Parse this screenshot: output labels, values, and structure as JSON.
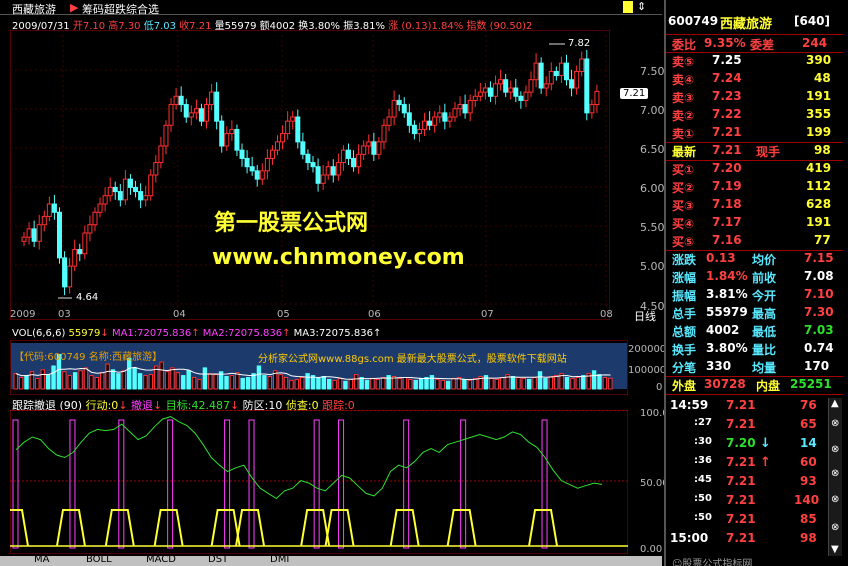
{
  "window": {
    "stock_name": "西藏旅游",
    "scheme_tab": "筹码超跌综合选",
    "code": "600749",
    "panel_stock": "西藏旅游",
    "panel_index": "[640]"
  },
  "info_bar": {
    "date": "2009/07/31",
    "open": "开7.10",
    "high": "高7.30",
    "low": "低7.03",
    "close": "收7.21",
    "volume": "量55979",
    "amount": "额4002",
    "turnover": "换3.80%",
    "amplitude": "振3.81%",
    "change": "涨 (0.13)1.84%",
    "index": "指数 (90.50)2"
  },
  "price_chart": {
    "y_ticks": [
      "7.50",
      "7.00",
      "6.50",
      "6.00",
      "5.50",
      "5.00",
      "4.50"
    ],
    "current_price": "7.21",
    "high_label": "7.82",
    "low_label": "4.64",
    "x_labels": [
      "2009",
      "03",
      "04",
      "05",
      "06",
      "07",
      "08"
    ],
    "period": "日线",
    "watermark_1": "第一股票公式网",
    "watermark_2": "www.chnmoney.com",
    "y_min": 4.45,
    "y_max": 7.95
  },
  "volume_panel": {
    "vol_label": "VOL(6,6,6)",
    "vol_value": "55979",
    "ma1": "MA1:72075.836",
    "ma2": "MA2:72075.836",
    "ma3": "MA3:72075.836",
    "banner_left": "【代码:600749  名称:西藏旅游】",
    "banner_right": "分析家公式网www.88gs.com 最新最大股票公式，股票软件下载网站",
    "y_ticks": [
      "200000",
      "100000",
      "0"
    ]
  },
  "indicator_panel": {
    "name": "跟踪撤退",
    "param": "(90)",
    "action": "行动:0",
    "retreat": "撤退",
    "target": "目标:42.487",
    "defense": "防区:10",
    "scout": "侦查:0",
    "tracking": "跟踪:0",
    "y_ticks": [
      "100.00",
      "50.00",
      "0.00"
    ]
  },
  "orderbook": {
    "ratio_label": "委比",
    "ratio_value": "9.35%",
    "diff_label": "委差",
    "diff_value": "244",
    "asks": [
      {
        "label": "卖⑤",
        "price": "7.25",
        "vol": "390"
      },
      {
        "label": "卖④",
        "price": "7.24",
        "vol": "48"
      },
      {
        "label": "卖③",
        "price": "7.23",
        "vol": "191"
      },
      {
        "label": "卖②",
        "price": "7.22",
        "vol": "355"
      },
      {
        "label": "卖①",
        "price": "7.21",
        "vol": "199"
      }
    ],
    "last_label": "最新",
    "last_price": "7.21",
    "now_label": "现手",
    "now_vol": "98",
    "bids": [
      {
        "label": "买①",
        "price": "7.20",
        "vol": "419"
      },
      {
        "label": "买②",
        "price": "7.19",
        "vol": "112"
      },
      {
        "label": "买③",
        "price": "7.18",
        "vol": "628"
      },
      {
        "label": "买④",
        "price": "7.17",
        "vol": "191"
      },
      {
        "label": "买⑤",
        "price": "7.16",
        "vol": "77"
      }
    ]
  },
  "stats": [
    {
      "l1": "涨跌",
      "v1": "0.13",
      "l2": "均价",
      "v2": "7.15",
      "c1": "#ff4040",
      "c2": "#ff4040"
    },
    {
      "l1": "涨幅",
      "v1": "1.84%",
      "l2": "前收",
      "v2": "7.08",
      "c1": "#ff4040",
      "c2": "#ffffff"
    },
    {
      "l1": "振幅",
      "v1": "3.81%",
      "l2": "今开",
      "v2": "7.10",
      "c1": "#ffffff",
      "c2": "#ff4040"
    },
    {
      "l1": "总手",
      "v1": "55979",
      "l2": "最高",
      "v2": "7.30",
      "c1": "#ffffff",
      "c2": "#ff4040"
    },
    {
      "l1": "总额",
      "v1": "4002",
      "l2": "最低",
      "v2": "7.03",
      "c1": "#ffffff",
      "c2": "#2ee02e"
    },
    {
      "l1": "换手",
      "v1": "3.80%",
      "l2": "量比",
      "v2": "0.74",
      "c1": "#ffffff",
      "c2": "#ffffff"
    },
    {
      "l1": "分笔",
      "v1": "330",
      "l2": "均量",
      "v2": "170",
      "c1": "#ffffff",
      "c2": "#ffffff"
    }
  ],
  "outer_label": "外盘",
  "outer_value": "30728",
  "inner_label": "内盘",
  "inner_value": "25251",
  "ticks": [
    {
      "time": "14:59",
      "price": "7.21",
      "arrow": "",
      "vol": "76"
    },
    {
      "time": ":27",
      "price": "7.21",
      "arrow": "",
      "vol": "65"
    },
    {
      "time": ":30",
      "price": "7.20",
      "arrow": "↓",
      "vol": "14"
    },
    {
      "time": ":36",
      "price": "7.21",
      "arrow": "↑",
      "vol": "60"
    },
    {
      "time": ":45",
      "price": "7.21",
      "arrow": "",
      "vol": "93"
    },
    {
      "time": ":50",
      "price": "7.21",
      "arrow": "",
      "vol": "140"
    },
    {
      "time": ":50",
      "price": "7.21",
      "arrow": "",
      "vol": "85"
    },
    {
      "time": "15:00",
      "price": "7.21",
      "arrow": "",
      "vol": "98"
    }
  ],
  "bottom_tabs": [
    "MA",
    "BOLL",
    "MACD",
    "DST",
    "DMI"
  ],
  "footer_watermark": "☺股票公式指标网",
  "chart_data": [
    {
      "type": "candlestick",
      "ylim": [
        4.45,
        7.95
      ],
      "values": [
        5.45,
        5.55,
        5.4,
        5.6,
        5.7,
        5.85,
        5.75,
        5.2,
        4.85,
        5.1,
        5.3,
        5.25,
        5.5,
        5.6,
        5.75,
        5.85,
        5.95,
        6.05,
        6.0,
        5.9,
        6.15,
        6.05,
        6.0,
        5.9,
        5.95,
        6.2,
        6.35,
        6.55,
        6.8,
        7.05,
        7.15,
        7.05,
        6.9,
        6.95,
        7.0,
        6.85,
        7.05,
        7.2,
        6.85,
        6.55,
        6.7,
        6.75,
        6.5,
        6.4,
        6.3,
        6.25,
        6.15,
        6.25,
        6.4,
        6.5,
        6.6,
        6.7,
        6.85,
        6.9,
        6.6,
        6.45,
        6.35,
        6.3,
        6.1,
        6.2,
        6.3,
        6.2,
        6.35,
        6.5,
        6.4,
        6.3,
        6.45,
        6.55,
        6.6,
        6.45,
        6.6,
        6.8,
        6.9,
        7.1,
        7.05,
        6.95,
        6.8,
        6.7,
        6.75,
        6.85,
        6.8,
        6.9,
        6.95,
        6.85,
        6.9,
        7.0,
        7.05,
        6.95,
        7.1,
        7.15,
        7.2,
        7.25,
        7.15,
        7.3,
        7.35,
        7.2,
        7.25,
        7.15,
        7.1,
        7.2,
        7.35,
        7.55,
        7.25,
        7.3,
        7.45,
        7.4,
        7.55,
        7.35,
        7.25,
        7.45,
        7.6,
        6.95,
        7.05,
        7.21
      ]
    },
    {
      "type": "bar",
      "ylim": [
        0,
        250000
      ],
      "values": [
        80000,
        60000,
        70000,
        90000,
        55000,
        100000,
        75000,
        120000,
        180000,
        90000,
        70000,
        85000,
        95000,
        110000,
        70000,
        60000,
        85000,
        130000,
        100000,
        80000,
        95000,
        160000,
        110000,
        80000,
        70000,
        75000,
        120000,
        140000,
        90000,
        110000,
        85000,
        70000,
        95000,
        60000,
        50000,
        110000,
        80000,
        75000,
        90000,
        65000,
        70000,
        85000,
        55000,
        60000,
        80000,
        120000,
        70000,
        65000,
        95000,
        75000,
        60000,
        45000,
        50000,
        60000,
        80000,
        70000,
        55000,
        65000,
        50000,
        45000,
        55000,
        40000,
        50000,
        75000,
        60000,
        45000,
        55000,
        50000,
        60000,
        70000,
        65000,
        55000,
        60000,
        50000,
        45000,
        55000,
        60000,
        70000,
        50000,
        45000,
        40000,
        55000,
        60000,
        50000,
        45000,
        55000,
        65000,
        70000,
        55000,
        50000,
        60000,
        75000,
        65000,
        60000,
        55000,
        50000,
        60000,
        90000,
        55000,
        65000,
        70000,
        80000,
        60000,
        55000,
        60000,
        70000,
        80000,
        95000,
        75000,
        60000,
        55979
      ]
    },
    {
      "type": "line",
      "ylim": [
        0,
        100
      ],
      "values": [
        72,
        78,
        82,
        80,
        73,
        68,
        66,
        70,
        78,
        85,
        88,
        87,
        88,
        92,
        86,
        80,
        83,
        90,
        96,
        98,
        94,
        91,
        85,
        76,
        66,
        60,
        55,
        58,
        60,
        50,
        42,
        38,
        34,
        40,
        42,
        48,
        46,
        42,
        40,
        46,
        52,
        50,
        44,
        38,
        36,
        42,
        55,
        60,
        58,
        63,
        70,
        73,
        70,
        76,
        78,
        80,
        82,
        84,
        82,
        80,
        82,
        86,
        84,
        78,
        74,
        66,
        56,
        48,
        45,
        42,
        44,
        46,
        45
      ]
    },
    {
      "type": "bar",
      "ylim": [
        0,
        100
      ],
      "values": [
        1,
        0,
        0,
        0,
        0,
        0,
        0,
        1,
        0,
        0,
        0,
        0,
        0,
        1,
        0,
        0,
        0,
        0,
        0,
        1,
        0,
        0,
        0,
        0,
        0,
        0,
        1,
        0,
        0,
        1,
        0,
        0,
        0,
        0,
        0,
        0,
        0,
        1,
        0,
        0,
        1,
        0,
        0,
        0,
        0,
        0,
        0,
        0,
        1,
        0,
        0,
        0,
        0,
        0,
        0,
        1,
        0,
        0,
        0,
        0,
        0,
        0,
        0,
        0,
        0,
        1,
        0,
        0,
        0,
        0,
        0,
        0,
        0
      ]
    }
  ]
}
